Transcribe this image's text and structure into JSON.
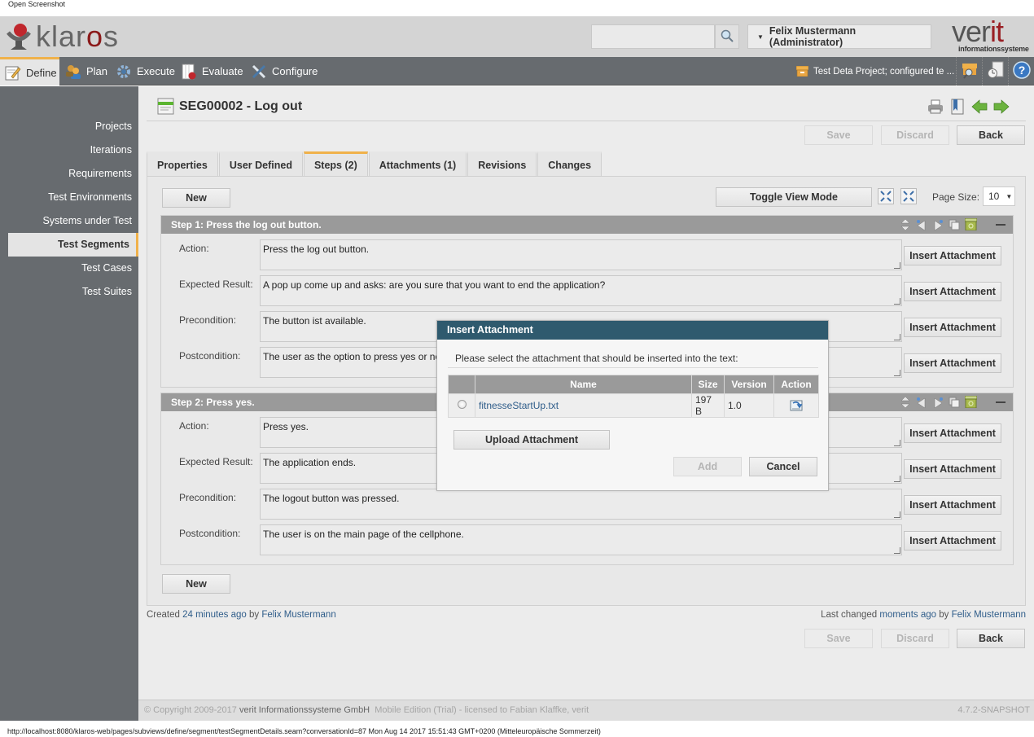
{
  "window": {
    "caption": "Open Screenshot"
  },
  "header": {
    "logo_text_prefix": "klar",
    "logo_text_o": "o",
    "logo_text_suffix": "s",
    "search_placeholder": "",
    "user_menu_label": "Felix Mustermann (Administrator)",
    "partner_logo_main": "ver",
    "partner_logo_accent": "it",
    "partner_logo_sub": "informationssysteme"
  },
  "nav": {
    "items": [
      {
        "label": "Define",
        "icon": "define-icon",
        "active": true
      },
      {
        "label": "Plan",
        "icon": "plan-icon"
      },
      {
        "label": "Execute",
        "icon": "execute-icon"
      },
      {
        "label": "Evaluate",
        "icon": "evaluate-icon"
      },
      {
        "label": "Configure",
        "icon": "configure-icon"
      }
    ],
    "project_label": "Test Deta Project; configured te ...",
    "tools": [
      "project-search-icon",
      "job-history-icon",
      "help-icon"
    ]
  },
  "sidebar": {
    "items": [
      {
        "label": "Projects"
      },
      {
        "label": "Iterations"
      },
      {
        "label": "Requirements"
      },
      {
        "label": "Test Environments"
      },
      {
        "label": "Systems under Test"
      },
      {
        "label": "Test Segments",
        "active": true
      },
      {
        "label": "Test Cases"
      },
      {
        "label": "Test Suites"
      }
    ]
  },
  "page": {
    "title": "SEG00002 - Log out",
    "buttons": {
      "save": "Save",
      "discard": "Discard",
      "back": "Back"
    },
    "tabs": [
      {
        "label": "Properties"
      },
      {
        "label": "User Defined"
      },
      {
        "label": "Steps (2)",
        "active": true
      },
      {
        "label": "Attachments (1)"
      },
      {
        "label": "Revisions"
      },
      {
        "label": "Changes"
      }
    ],
    "toolbar": {
      "new_label": "New",
      "toggle_view_label": "Toggle View Mode",
      "page_size_label": "Page Size:",
      "page_size_value": "10"
    },
    "field_labels": {
      "action": "Action:",
      "expected": "Expected Result:",
      "precondition": "Precondition:",
      "postcondition": "Postcondition:"
    },
    "insert_attachment_label": "Insert Attachment",
    "steps": [
      {
        "title": "Step 1: Press the log out button.",
        "action": "Press the log out button.",
        "expected": "A pop up come up and asks: are you sure that you want to end the application?",
        "precondition": "The button ist available.",
        "postcondition": "The user as the option to press yes or no."
      },
      {
        "title": "Step 2: Press yes.",
        "action": "Press yes.",
        "expected": "The application ends.",
        "precondition": "The logout button was pressed.",
        "postcondition": "The user is on the main page of the cellphone."
      }
    ],
    "meta": {
      "created_prefix": "Created",
      "created_when": "24 minutes ago",
      "created_by_word": "by",
      "created_by": "Felix Mustermann",
      "changed_prefix": "Last changed",
      "changed_when": "moments ago",
      "changed_by_word": "by",
      "changed_by": "Felix Mustermann"
    }
  },
  "modal": {
    "title": "Insert Attachment",
    "message": "Please select the attachment that should be inserted into the text:",
    "columns": [
      "",
      "Name",
      "Size",
      "Version",
      "Action"
    ],
    "rows": [
      {
        "name": "fitnesseStartUp.txt",
        "size": "197 B",
        "version": "1.0",
        "action_icon": "download-icon"
      }
    ],
    "upload_label": "Upload Attachment",
    "add_label": "Add",
    "cancel_label": "Cancel"
  },
  "footer": {
    "copyright_prefix": "© Copyright 2009-2017",
    "company": "verit Informationssysteme GmbH",
    "license": "Mobile Edition (Trial) - licensed to Fabian Klaffke, verit",
    "version": "4.7.2-SNAPSHOT"
  },
  "statusbar": {
    "text": "http://localhost:8080/klaros-web/pages/subviews/define/segment/testSegmentDetails.seam?conversationId=87 Mon Aug 14 2017 15:51:43 GMT+0200 (Mitteleuropäische Sommerzeit)"
  }
}
